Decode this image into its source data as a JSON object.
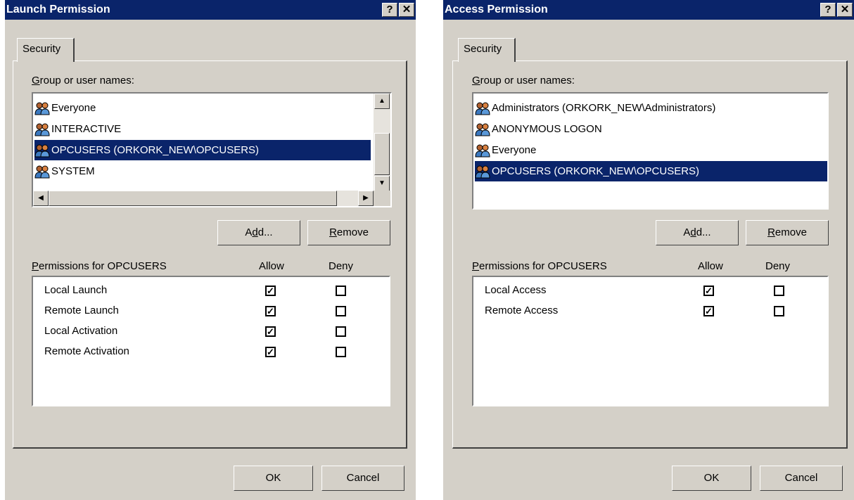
{
  "dialogs": [
    {
      "title": "Launch Permission",
      "tab": "Security",
      "group_label": "Group or user names:",
      "group_label_key": "G",
      "group_label_rest": "roup or user names:",
      "users": [
        {
          "name": "Everyone",
          "selected": false
        },
        {
          "name": "INTERACTIVE",
          "selected": false
        },
        {
          "name": "OPCUSERS (ORKORK_NEW\\OPCUSERS)",
          "selected": true
        },
        {
          "name": "SYSTEM",
          "selected": false
        }
      ],
      "add_label": {
        "pre": "A",
        "key": "d",
        "post": "d..."
      },
      "remove_label": {
        "pre": "",
        "key": "R",
        "post": "emove"
      },
      "perm_header": {
        "key": "P",
        "rest": "ermissions for OPCUSERS",
        "allow": "Allow",
        "deny": "Deny"
      },
      "permissions": [
        {
          "name": "Local Launch",
          "allow": true,
          "deny": false
        },
        {
          "name": "Remote Launch",
          "allow": true,
          "deny": false
        },
        {
          "name": "Local Activation",
          "allow": true,
          "deny": false
        },
        {
          "name": "Remote Activation",
          "allow": true,
          "deny": false
        }
      ],
      "ok_label": "OK",
      "cancel_label": "Cancel",
      "help_glyph": "?",
      "close_glyph": "✕",
      "has_scrollbars": true
    },
    {
      "title": "Access Permission",
      "tab": "Security",
      "group_label_key": "G",
      "group_label_rest": "roup or user names:",
      "users": [
        {
          "name": "Administrators (ORKORK_NEW\\Administrators)",
          "selected": false
        },
        {
          "name": "ANONYMOUS LOGON",
          "selected": false
        },
        {
          "name": "Everyone",
          "selected": false
        },
        {
          "name": "OPCUSERS (ORKORK_NEW\\OPCUSERS)",
          "selected": true
        }
      ],
      "add_label": {
        "pre": "A",
        "key": "d",
        "post": "d..."
      },
      "remove_label": {
        "pre": "",
        "key": "R",
        "post": "emove"
      },
      "perm_header": {
        "key": "P",
        "rest": "ermissions for OPCUSERS",
        "allow": "Allow",
        "deny": "Deny"
      },
      "permissions": [
        {
          "name": "Local Access",
          "allow": true,
          "deny": false
        },
        {
          "name": "Remote Access",
          "allow": true,
          "deny": false
        }
      ],
      "ok_label": "OK",
      "cancel_label": "Cancel",
      "help_glyph": "?",
      "close_glyph": "✕",
      "has_scrollbars": false
    }
  ],
  "colors": {
    "titlebar": "#0a246a",
    "face": "#d4d0c8",
    "selection": "#0a246a"
  },
  "icons": {
    "user_group": "users-group-icon",
    "check": "✓"
  }
}
